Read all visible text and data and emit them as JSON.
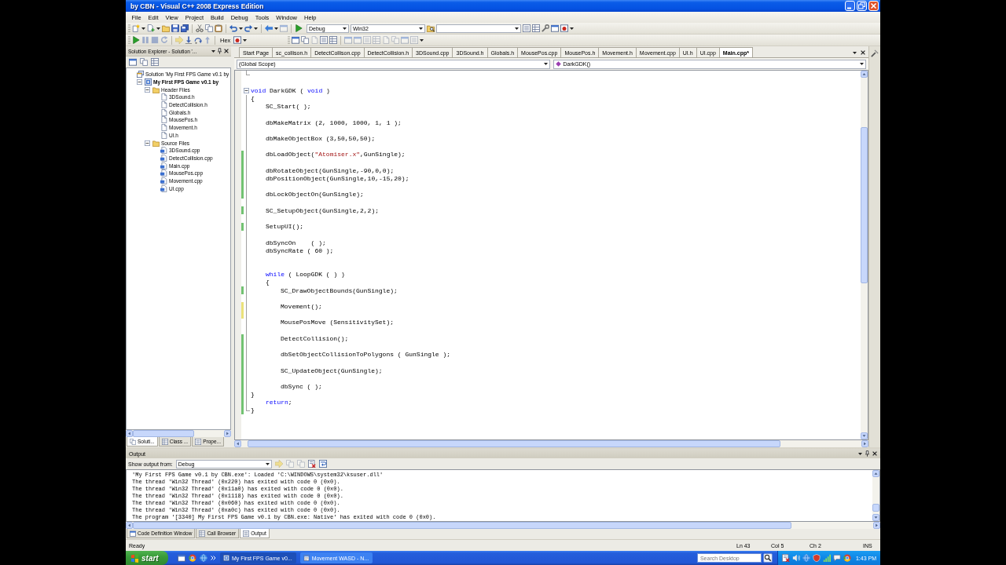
{
  "window": {
    "title": "by CBN - Visual C++ 2008 Express Edition"
  },
  "menu": [
    "File",
    "Edit",
    "View",
    "Project",
    "Build",
    "Debug",
    "Tools",
    "Window",
    "Help"
  ],
  "toolbar": {
    "configuration": "Debug",
    "platform": "Win32",
    "hex_button": "Hex"
  },
  "solution_explorer": {
    "title": "Solution Explorer - Solution '...",
    "tree": [
      {
        "label": "Solution 'My First FPS Game v0.1 by",
        "kind": "solution",
        "children": [
          {
            "label": "My First FPS Game v0.1 by",
            "kind": "project",
            "expanded": true,
            "children": [
              {
                "label": "Header Files",
                "kind": "folder",
                "expanded": true,
                "children": [
                  {
                    "label": "3DSound.h",
                    "kind": "header"
                  },
                  {
                    "label": "DetectCollision.h",
                    "kind": "header"
                  },
                  {
                    "label": "Globals.h",
                    "kind": "header"
                  },
                  {
                    "label": "MousePos.h",
                    "kind": "header"
                  },
                  {
                    "label": "Movement.h",
                    "kind": "header"
                  },
                  {
                    "label": "UI.h",
                    "kind": "header"
                  }
                ]
              },
              {
                "label": "Source Files",
                "kind": "folder",
                "expanded": true,
                "children": [
                  {
                    "label": "3DSound.cpp",
                    "kind": "source"
                  },
                  {
                    "label": "DetectCollision.cpp",
                    "kind": "source"
                  },
                  {
                    "label": "Main.cpp",
                    "kind": "source"
                  },
                  {
                    "label": "MousePos.cpp",
                    "kind": "source"
                  },
                  {
                    "label": "Movement.cpp",
                    "kind": "source"
                  },
                  {
                    "label": "UI.cpp",
                    "kind": "source"
                  }
                ]
              }
            ]
          }
        ]
      }
    ],
    "tabs": [
      {
        "label": "Soluti...",
        "selected": true
      },
      {
        "label": "Class ...",
        "selected": false
      },
      {
        "label": "Prope...",
        "selected": false
      }
    ]
  },
  "document_tabs": [
    {
      "label": "Start Page",
      "selected": false
    },
    {
      "label": "sc_collison.h",
      "selected": false
    },
    {
      "label": "DetectCollison.cpp",
      "selected": false
    },
    {
      "label": "DetectCollision.h",
      "selected": false
    },
    {
      "label": "3DSound.cpp",
      "selected": false
    },
    {
      "label": "3DSound.h",
      "selected": false
    },
    {
      "label": "Globals.h",
      "selected": false
    },
    {
      "label": "MousePos.cpp",
      "selected": false
    },
    {
      "label": "MousePos.h",
      "selected": false
    },
    {
      "label": "Movement.h",
      "selected": false
    },
    {
      "label": "Movement.cpp",
      "selected": false
    },
    {
      "label": "UI.h",
      "selected": false
    },
    {
      "label": "UI.cpp",
      "selected": false
    },
    {
      "label": "Main.cpp*",
      "selected": true
    }
  ],
  "editor": {
    "scope": "(Global Scope)",
    "member": "DarkGDK()",
    "lines": [
      {
        "kind": "region_end"
      },
      {
        "kind": "blank"
      },
      {
        "kind": "region",
        "tokens": [
          {
            "kind": "keyword",
            "text": "void"
          },
          {
            "kind": "plain",
            "text": " DarkGDK ( "
          },
          {
            "kind": "keyword",
            "text": "void"
          },
          {
            "kind": "plain",
            "text": " )"
          }
        ]
      },
      {
        "kind": "code",
        "text": "{"
      },
      {
        "kind": "block",
        "children": [
          {
            "kind": "code",
            "text": "SC_Start( );"
          },
          {
            "kind": "blank"
          },
          {
            "kind": "code",
            "text": "dbMakeMatrix (2, 1000, 1000, 1, 1 );"
          },
          {
            "kind": "blank"
          },
          {
            "kind": "code",
            "text": "dbMakeObjectBox (3,50,50,50);"
          },
          {
            "kind": "blank"
          },
          {
            "kind": "code",
            "color": "#72c272",
            "tokens": [
              {
                "kind": "plain",
                "text": "dbLoadObject("
              },
              {
                "kind": "string",
                "text": "\"Atomiser.x\""
              },
              {
                "kind": "plain",
                "text": ",GunSingle);"
              }
            ]
          },
          {
            "kind": "blank",
            "color": "#72c272"
          },
          {
            "kind": "code",
            "color": "#72c272",
            "text": "dbRotateObject(GunSingle,-90,0,0);"
          },
          {
            "kind": "code",
            "color": "#72c272",
            "text": "dbPositionObject(GunSingle,10,-15,20);"
          },
          {
            "kind": "blank",
            "color": "#72c272"
          },
          {
            "kind": "code",
            "color": "#72c272",
            "text": "dbLockObjectOn(GunSingle);"
          },
          {
            "kind": "blank"
          },
          {
            "kind": "code",
            "color": "#72c272",
            "text": "SC_SetupObject(GunSingle,2,2);"
          },
          {
            "kind": "blank"
          },
          {
            "kind": "code",
            "color": "#72c272",
            "text": "SetupUI();"
          },
          {
            "kind": "blank"
          },
          {
            "kind": "code",
            "text": "dbSyncOn    ( );"
          },
          {
            "kind": "code",
            "text": "dbSyncRate ( 60 );"
          },
          {
            "kind": "blank"
          },
          {
            "kind": "blank"
          },
          {
            "kind": "code",
            "tokens": [
              {
                "kind": "keyword",
                "text": "while"
              },
              {
                "kind": "plain",
                "text": " ( LoopGDK ( ) )"
              }
            ]
          },
          {
            "kind": "code",
            "text": "{"
          },
          {
            "kind": "block",
            "children": [
              {
                "kind": "code",
                "color": "#72c272",
                "text": "SC_DrawObjectBounds(GunSingle);"
              },
              {
                "kind": "blank"
              },
              {
                "kind": "code",
                "color": "#ebe27a",
                "text": "Movement();"
              },
              {
                "kind": "blank",
                "color": "#ebe27a"
              },
              {
                "kind": "code",
                "text": "MousePosMove (SensitivitySet);"
              },
              {
                "kind": "blank"
              },
              {
                "kind": "code",
                "color": "#72c272",
                "text": "DetectCollision();"
              },
              {
                "kind": "blank",
                "color": "#72c272"
              },
              {
                "kind": "code",
                "color": "#72c272",
                "text": "dbSetObjectCollisionToPolygons ( GunSingle );"
              },
              {
                "kind": "blank",
                "color": "#72c272"
              },
              {
                "kind": "code",
                "color": "#72c272",
                "text": "SC_UpdateObject(GunSingle);"
              },
              {
                "kind": "blank",
                "color": "#72c272"
              },
              {
                "kind": "code",
                "color": "#72c272",
                "text": "dbSync ( );"
              }
            ]
          }
        ]
      },
      {
        "kind": "code",
        "color": "#72c272",
        "text": "}"
      },
      {
        "kind": "block",
        "children": [
          {
            "kind": "code",
            "color": "#72c272",
            "tokens": [
              {
                "kind": "keyword",
                "text": "return"
              },
              {
                "kind": "plain",
                "text": ";"
              }
            ]
          }
        ]
      },
      {
        "kind": "code",
        "color": "#72c272",
        "text": "}"
      }
    ]
  },
  "output": {
    "title": "Output",
    "source_label": "Show output from:",
    "source": "Debug",
    "lines": [
      "'My First FPS Game v0.1 by CBN.exe': Loaded 'C:\\WINDOWS\\system32\\ksuser.dll'",
      "The thread 'Win32 Thread' (0x220) has exited with code 0 (0x0).",
      "The thread 'Win32 Thread' (0x11a0) has exited with code 0 (0x0).",
      "The thread 'Win32 Thread' (0x1118) has exited with code 0 (0x0).",
      "The thread 'Win32 Thread' (0x060) has exited with code 0 (0x0).",
      "The thread 'Win32 Thread' (0xa0c) has exited with code 0 (0x0).",
      "The program '[3340] My First FPS Game v0.1 by CBN.exe: Native' has exited with code 0 (0x0)."
    ],
    "tabs": [
      {
        "label": "Code Definition Window",
        "selected": false
      },
      {
        "label": "Call Browser",
        "selected": false
      },
      {
        "label": "Output",
        "selected": true
      }
    ]
  },
  "status_bar": {
    "message": "Ready",
    "line": "Ln 43",
    "column": "Col 5",
    "char": "Ch 2",
    "mode": "INS"
  },
  "taskbar": {
    "start": "start",
    "tasks": [
      {
        "label": "My First FPS Game v0...",
        "selected": true
      },
      {
        "label": "Movement WASD - N...",
        "selected": false
      }
    ],
    "search": {
      "placeholder": "Search Desktop"
    },
    "clock": "1:43 PM"
  }
}
